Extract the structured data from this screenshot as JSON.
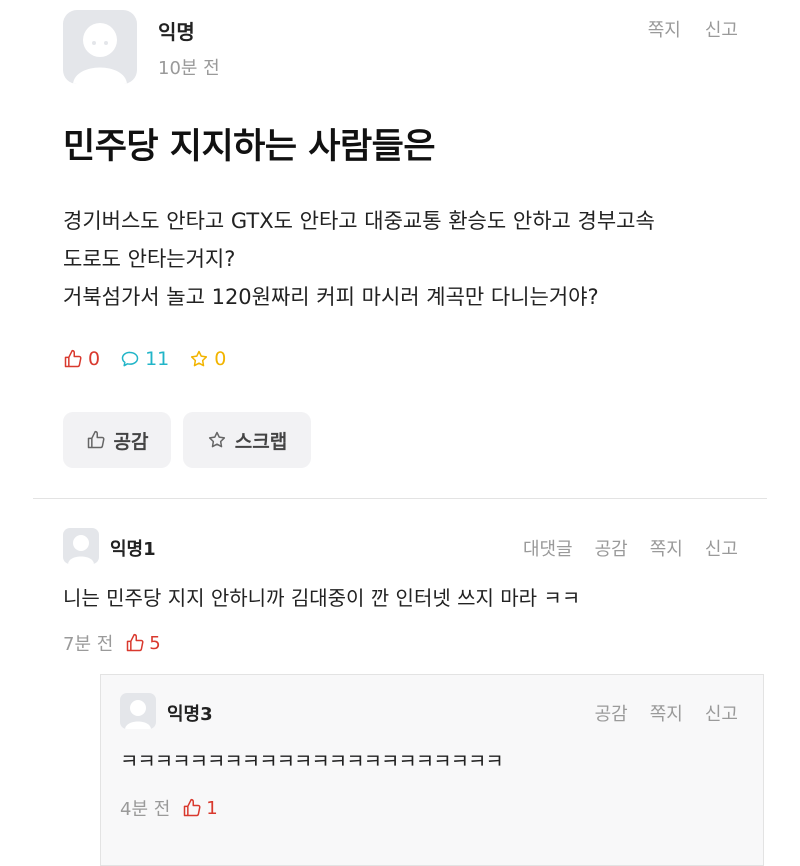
{
  "post": {
    "author": "익명",
    "time": "10분 전",
    "actions": [
      "쪽지",
      "신고"
    ],
    "title": "민주당 지지하는 사람들은",
    "body_lines": [
      "경기버스도 안타고 GTX도 안타고 대중교통 환승도 안하고 경부고속",
      "도로도 안타는거지?",
      "거북섬가서 놀고 120원짜리 커피 마시러 계곡만 다니는거야?"
    ],
    "stats": {
      "likes": "0",
      "comments": "11",
      "scraps": "0"
    },
    "buttons": {
      "like": "공감",
      "scrap": "스크랩"
    }
  },
  "comments": [
    {
      "author": "익명1",
      "actions": [
        "대댓글",
        "공감",
        "쪽지",
        "신고"
      ],
      "text": "니는 민주당 지지 안하니까 김대중이 깐 인터넷 쓰지 마라 ㅋㅋ",
      "time": "7분 전",
      "likes": "5"
    }
  ],
  "replies": [
    {
      "author": "익명3",
      "actions": [
        "공감",
        "쪽지",
        "신고"
      ],
      "text": "ㅋㅋㅋㅋㅋㅋㅋㅋㅋㅋㅋㅋㅋㅋㅋㅋㅋㅋㅋㅋㅋㅋ",
      "time": "4분 전",
      "likes": "1"
    }
  ],
  "colors": {
    "like": "#d9392e",
    "comment": "#21b5c8",
    "scrap": "#f2b400"
  }
}
